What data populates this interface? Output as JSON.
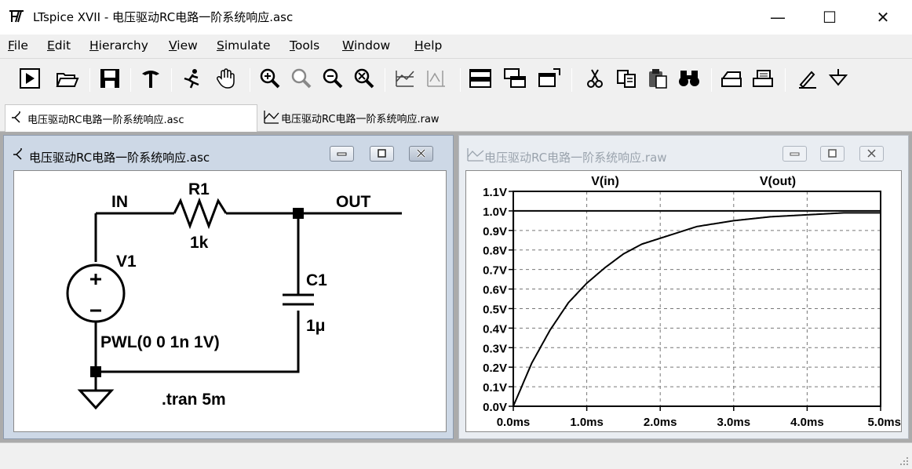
{
  "window": {
    "title": "LTspice XVII - 电压驱动RC电路一阶系统响应.asc",
    "minimize_glyph": "—",
    "maximize_glyph": "☐",
    "close_glyph": "✕"
  },
  "menu": [
    "File",
    "Edit",
    "Hierarchy",
    "View",
    "Simulate",
    "Tools",
    "Window",
    "Help"
  ],
  "toolbar_icons": [
    "run-icon",
    "open-icon",
    "save-icon",
    "control-panel-icon",
    "halt-icon",
    "pan-icon",
    "zoom-in-icon",
    "zoom-fit-icon",
    "zoom-out-icon",
    "zoom-cancel-icon",
    "autorange-icon",
    "pick-trace-icon",
    "tile-horizontal-icon",
    "cascade-icon",
    "close-all-icon",
    "cut-icon",
    "copy-icon",
    "paste-icon",
    "find-icon",
    "print-preview-icon",
    "print-icon",
    "draw-wire-icon",
    "ground-icon"
  ],
  "tabs": [
    {
      "label": "电压驱动RC电路一阶系统响应.asc",
      "icon": "schematic-icon",
      "active": true
    },
    {
      "label": "电压驱动RC电路一阶系统响应.raw",
      "icon": "waveform-icon",
      "active": false
    }
  ],
  "schematic_window": {
    "title": "电压驱动RC电路一阶系统响应.asc",
    "labels": {
      "in": "IN",
      "out": "OUT",
      "r1_name": "R1",
      "r1_value": "1k",
      "c1_name": "C1",
      "c1_value": "1μ",
      "v1_name": "V1",
      "v1_value": "PWL(0 0 1n 1V)",
      "directive": ".tran 5m"
    }
  },
  "waveform_window": {
    "title": "电压驱动RC电路一阶系统响应.raw",
    "chart_data": {
      "type": "line",
      "title": "",
      "xlabel": "",
      "ylabel": "",
      "x_ticks": [
        "0.0ms",
        "1.0ms",
        "2.0ms",
        "3.0ms",
        "4.0ms",
        "5.0ms"
      ],
      "y_ticks": [
        "0.0V",
        "0.1V",
        "0.2V",
        "0.3V",
        "0.4V",
        "0.5V",
        "0.6V",
        "0.7V",
        "0.8V",
        "0.9V",
        "1.0V",
        "1.1V"
      ],
      "xlim": [
        0,
        5
      ],
      "ylim": [
        0,
        1.1
      ],
      "x_unit": "ms",
      "y_unit": "V",
      "grid": true,
      "series": [
        {
          "name": "V(in)",
          "color": "#000000",
          "x": [
            0,
            0.001,
            5
          ],
          "y": [
            0,
            1.0,
            1.0
          ]
        },
        {
          "name": "V(out)",
          "color": "#000000",
          "x": [
            0,
            0.25,
            0.5,
            0.75,
            1.0,
            1.25,
            1.5,
            1.75,
            2.0,
            2.5,
            3.0,
            3.5,
            4.0,
            4.5,
            5.0
          ],
          "y": [
            0,
            0.22,
            0.39,
            0.53,
            0.63,
            0.71,
            0.78,
            0.83,
            0.86,
            0.92,
            0.95,
            0.97,
            0.98,
            0.99,
            0.99
          ]
        }
      ]
    }
  }
}
